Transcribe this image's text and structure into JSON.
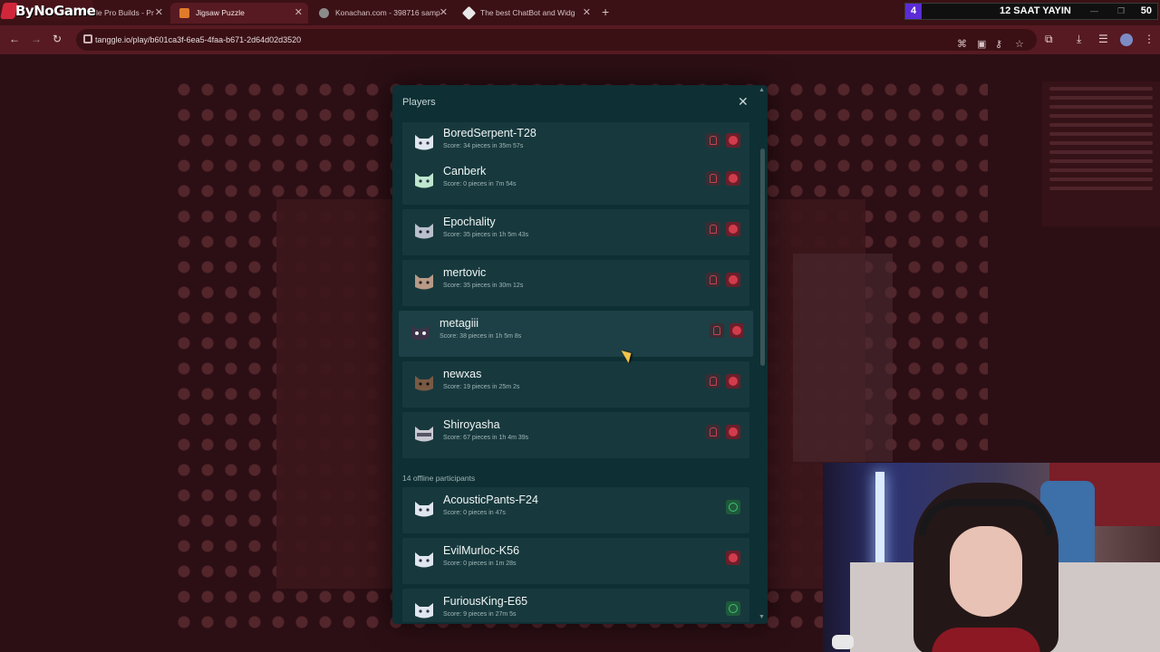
{
  "browser": {
    "brand": "ByNoGame",
    "tabs": [
      {
        "label": "le Pro Builds - Pr",
        "active": false
      },
      {
        "label": "Jigsaw Puzzle",
        "active": true
      },
      {
        "label": "Konachan.com - 398716 samp",
        "active": false
      },
      {
        "label": "The best ChatBot and Widg",
        "active": false
      }
    ],
    "url": "tanggle.io/play/b601ca3f-6ea5-4faa-b671-2d64d02d3520",
    "stream_overlay": {
      "left_number": "4",
      "title": "12 SAAT YAYIN",
      "right_number": "50"
    }
  },
  "players_panel": {
    "title": "Players",
    "online_players": [
      {
        "name": "BoredSerpent-T28",
        "score": "Score: 34 pieces in 35m 57s",
        "avatar": "cat-avatar-white"
      },
      {
        "name": "Canberk",
        "score": "Score: 0 pieces in 7m 54s",
        "avatar": "cat-avatar-green"
      },
      {
        "name": "Epochality",
        "score": "Score: 35 pieces in 1h 5m 43s",
        "avatar": "cat-avatar-gray"
      },
      {
        "name": "mertovic",
        "score": "Score: 35 pieces in 30m 12s",
        "avatar": "cat-avatar-brown"
      },
      {
        "name": "metagiii",
        "score": "Score: 38 pieces in 1h 5m 8s",
        "avatar": "cat-avatar-dark"
      },
      {
        "name": "newxas",
        "score": "Score: 19 pieces in 25m 2s",
        "avatar": "cat-avatar-calico"
      },
      {
        "name": "Shiroyasha",
        "score": "Score: 67 pieces in 1h 4m 39s",
        "avatar": "cat-avatar-mask"
      }
    ],
    "offline_label": "14 offline participants",
    "offline_players": [
      {
        "name": "AcousticPants-F24",
        "score": "Score: 0 pieces in 47s",
        "action": "ok"
      },
      {
        "name": "EvilMurloc-K56",
        "score": "Score: 0 pieces in 1m 28s",
        "action": "ban"
      },
      {
        "name": "FuriousKing-E65",
        "score": "Score: 9 pieces in 27m 5s",
        "action": "ok"
      }
    ]
  },
  "colors": {
    "accent_red": "#d13c4c",
    "accent_green": "#3fc37a",
    "panel_bg": "#0e2f33",
    "row_bg": "#17393d"
  }
}
